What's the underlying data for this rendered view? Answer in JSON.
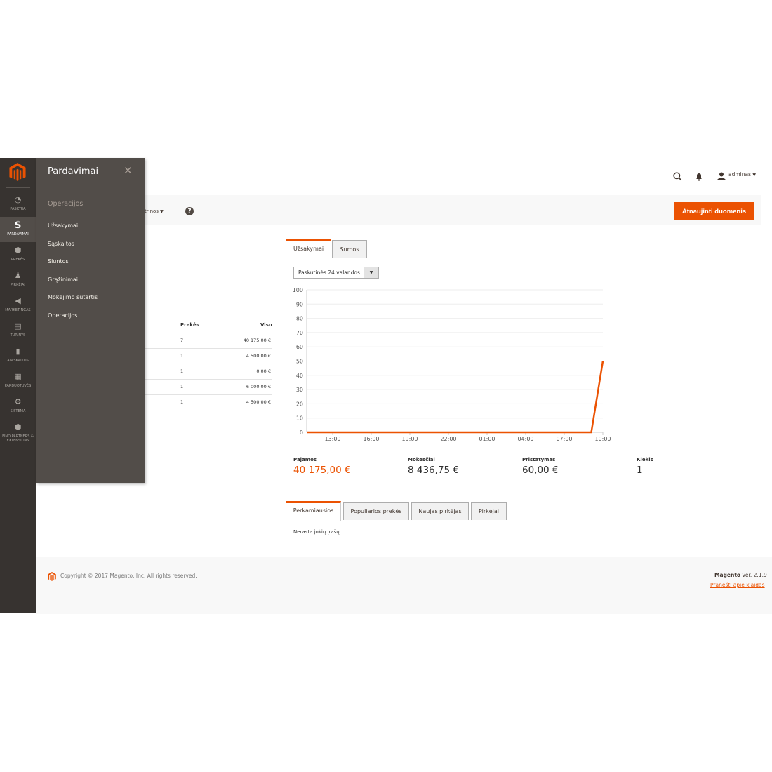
{
  "colors": {
    "accent": "#eb5202",
    "nav_bg": "#373330",
    "flyout_bg": "#524d49"
  },
  "nav": {
    "items": [
      {
        "label": "PASKYRA",
        "icon": "speedometer-icon",
        "active": false
      },
      {
        "label": "PARDAVIMAI",
        "icon": "dollar-icon",
        "active": true
      },
      {
        "label": "PREKĖS",
        "icon": "cube-icon",
        "active": false
      },
      {
        "label": "PIRKĖJAI",
        "icon": "person-icon",
        "active": false
      },
      {
        "label": "MARKETINGAS",
        "icon": "megaphone-icon",
        "active": false
      },
      {
        "label": "TURINYS",
        "icon": "layout-icon",
        "active": false
      },
      {
        "label": "ATASKAITOS",
        "icon": "bar-chart-icon",
        "active": false
      },
      {
        "label": "PARDUOTUVĖS",
        "icon": "store-icon",
        "active": false
      },
      {
        "label": "SISTEMA",
        "icon": "gear-icon",
        "active": false
      },
      {
        "label": "FIND PARTNERS & EXTENSIONS",
        "icon": "box-icon",
        "active": false
      }
    ]
  },
  "flyout": {
    "title": "Pardavimai",
    "section": "Operacijos",
    "links": [
      "Užsakymai",
      "Sąskaitos",
      "Siuntos",
      "Grąžinimai",
      "Mokėjimo sutartis",
      "Operacijos"
    ]
  },
  "header": {
    "user": "adminas",
    "scope_tail": "trinos",
    "refresh_button": "Atnaujinti duomenis"
  },
  "orders_table": {
    "headers": {
      "items": "Prekės",
      "total": "Viso"
    },
    "rows": [
      {
        "items": "7",
        "total": "40 175,00 €"
      },
      {
        "items": "1",
        "total": "4 500,00 €"
      },
      {
        "items": "1",
        "total": "0,00 €"
      },
      {
        "items": "1",
        "total": "6 000,00 €"
      },
      {
        "items": "1",
        "total": "4 500,00 €"
      }
    ]
  },
  "chart_tabs": [
    "Užsakymai",
    "Sumos"
  ],
  "period_select": "Paskutinės 24 valandos",
  "chart_data": {
    "type": "line",
    "x": [
      "13:00",
      "16:00",
      "19:00",
      "22:00",
      "01:00",
      "04:00",
      "07:00",
      "10:00"
    ],
    "y_ticks": [
      0,
      10,
      20,
      30,
      40,
      50,
      60,
      70,
      80,
      90,
      100
    ],
    "ylim": [
      0,
      100
    ],
    "line_color": "#eb5202",
    "series": [
      {
        "points": [
          [
            0,
            0
          ],
          [
            1,
            0
          ],
          [
            2,
            0
          ],
          [
            3,
            0
          ],
          [
            4,
            0
          ],
          [
            5,
            0
          ],
          [
            6,
            0
          ],
          [
            6.7,
            0
          ],
          [
            7,
            50
          ]
        ]
      }
    ]
  },
  "totals": [
    {
      "label": "Pajamos",
      "value": "40 175,00 €",
      "accent": true
    },
    {
      "label": "Mokesčiai",
      "value": "8 436,75 €",
      "accent": false
    },
    {
      "label": "Pristatymas",
      "value": "60,00 €",
      "accent": false
    },
    {
      "label": "Kiekis",
      "value": "1",
      "accent": false
    }
  ],
  "bottom_tabs": [
    "Perkamiausios",
    "Populiarios prekės",
    "Naujas pirkėjas",
    "Pirkėjai"
  ],
  "empty_message": "Nerasta jokių įrašų.",
  "footer": {
    "copyright": "Copyright © 2017 Magento, Inc. All rights reserved.",
    "brand": "Magento",
    "version": " ver. 2.1.9",
    "report_link": "Pranešti apie klaidas"
  }
}
